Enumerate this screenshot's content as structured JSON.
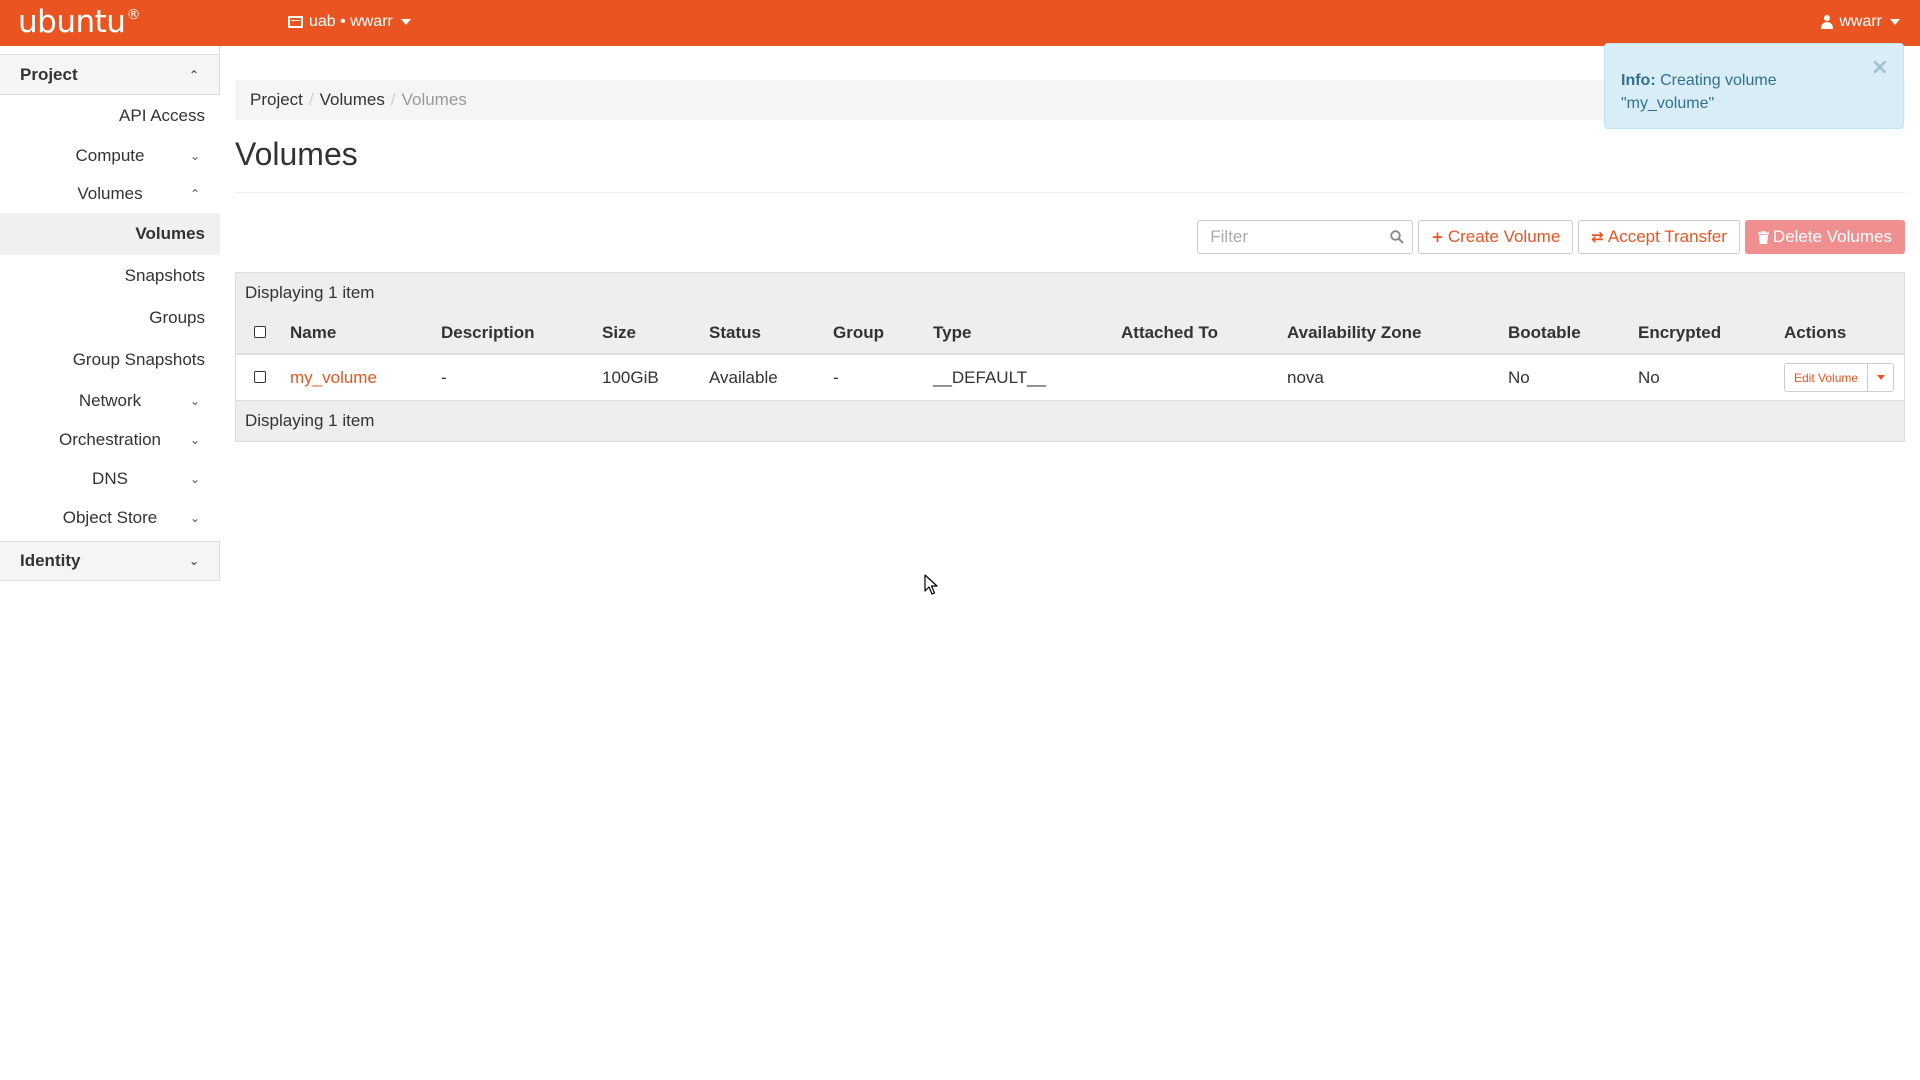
{
  "topbar": {
    "brand": "ubuntu",
    "brand_mark": "®",
    "project_switcher": "uab • wwarr",
    "user": "wwarr",
    "color": "#e95420"
  },
  "sidebar": {
    "project_section": "Project",
    "items": [
      {
        "label": "API Access"
      },
      {
        "label": "Compute"
      },
      {
        "label": "Volumes"
      },
      {
        "label": "Volumes"
      },
      {
        "label": "Snapshots"
      },
      {
        "label": "Groups"
      },
      {
        "label": "Group Snapshots"
      },
      {
        "label": "Network"
      },
      {
        "label": "Orchestration"
      },
      {
        "label": "DNS"
      },
      {
        "label": "Object Store"
      }
    ],
    "identity_section": "Identity"
  },
  "breadcrumb": [
    "Project",
    "Volumes",
    "Volumes"
  ],
  "page": {
    "title": "Volumes"
  },
  "toolbar": {
    "filter_placeholder": "Filter",
    "create_label": "Create Volume",
    "accept_label": "Accept Transfer",
    "delete_label": "Delete Volumes"
  },
  "table": {
    "caption": "Displaying 1 item",
    "footer": "Displaying 1 item",
    "columns": [
      "Name",
      "Description",
      "Size",
      "Status",
      "Group",
      "Type",
      "Attached To",
      "Availability Zone",
      "Bootable",
      "Encrypted",
      "Actions"
    ],
    "rows": [
      {
        "name": "my_volume",
        "description": "-",
        "size": "100GiB",
        "status": "Available",
        "group": "-",
        "type": "__DEFAULT__",
        "attached_to": "",
        "availability_zone": "nova",
        "bootable": "No",
        "encrypted": "No",
        "action": "Edit Volume"
      }
    ]
  },
  "toast": {
    "heading": "Info:",
    "message": "Creating volume \"my_volume\"",
    "close": "×"
  },
  "icons": {
    "chevron_up": "⌃",
    "chevron_down": "⌄",
    "plus": "+",
    "transfer": "⇄",
    "trash": "🗑"
  }
}
